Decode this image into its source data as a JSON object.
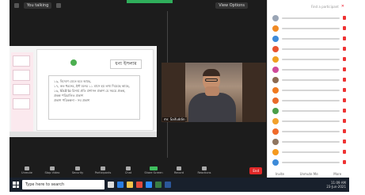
{
  "topbar": {
    "talking_label": "You talking",
    "view_label": "View Options"
  },
  "share": {
    "slide_title": "ধন্য ইসলাম",
    "slide_lines": [
      "১৯, বিদেশে যেতে হবে আছে,",
      "১৭, কত ধরনের, ইন্ট মনের ১১ মাসে হয় তথ্য দিয়েছে আছে,",
      "১৬, Visit to রিসার্চ প্রতি প্রশাসন প্রকাশ যে সময়ে প্রকল্প,",
      "   প্রকল্প পরিচালিত প্রকাশ",
      "   প্রকাশ পরিকল্পনা - সব প্রকাশ"
    ]
  },
  "speaker": {
    "name": "mr. Saifuddin"
  },
  "toolbar": {
    "buttons": [
      "Unmute",
      "Stop Video",
      "Security",
      "Participants",
      "Chat",
      "Share Screen",
      "Record",
      "Reactions",
      "Apps",
      "Whiteboards"
    ],
    "end_label": "End"
  },
  "panel": {
    "header_label": "Find a participant",
    "footer": [
      "Invite",
      "Unmute Me",
      "More"
    ]
  },
  "taskbar": {
    "search_placeholder": "Type here to search",
    "time": "11:09 AM",
    "date": "23-Jun-2021"
  },
  "colors": {
    "zoom_bg": "#1c1c1c",
    "end_button": "#e02828",
    "green": "#2fae5b"
  }
}
